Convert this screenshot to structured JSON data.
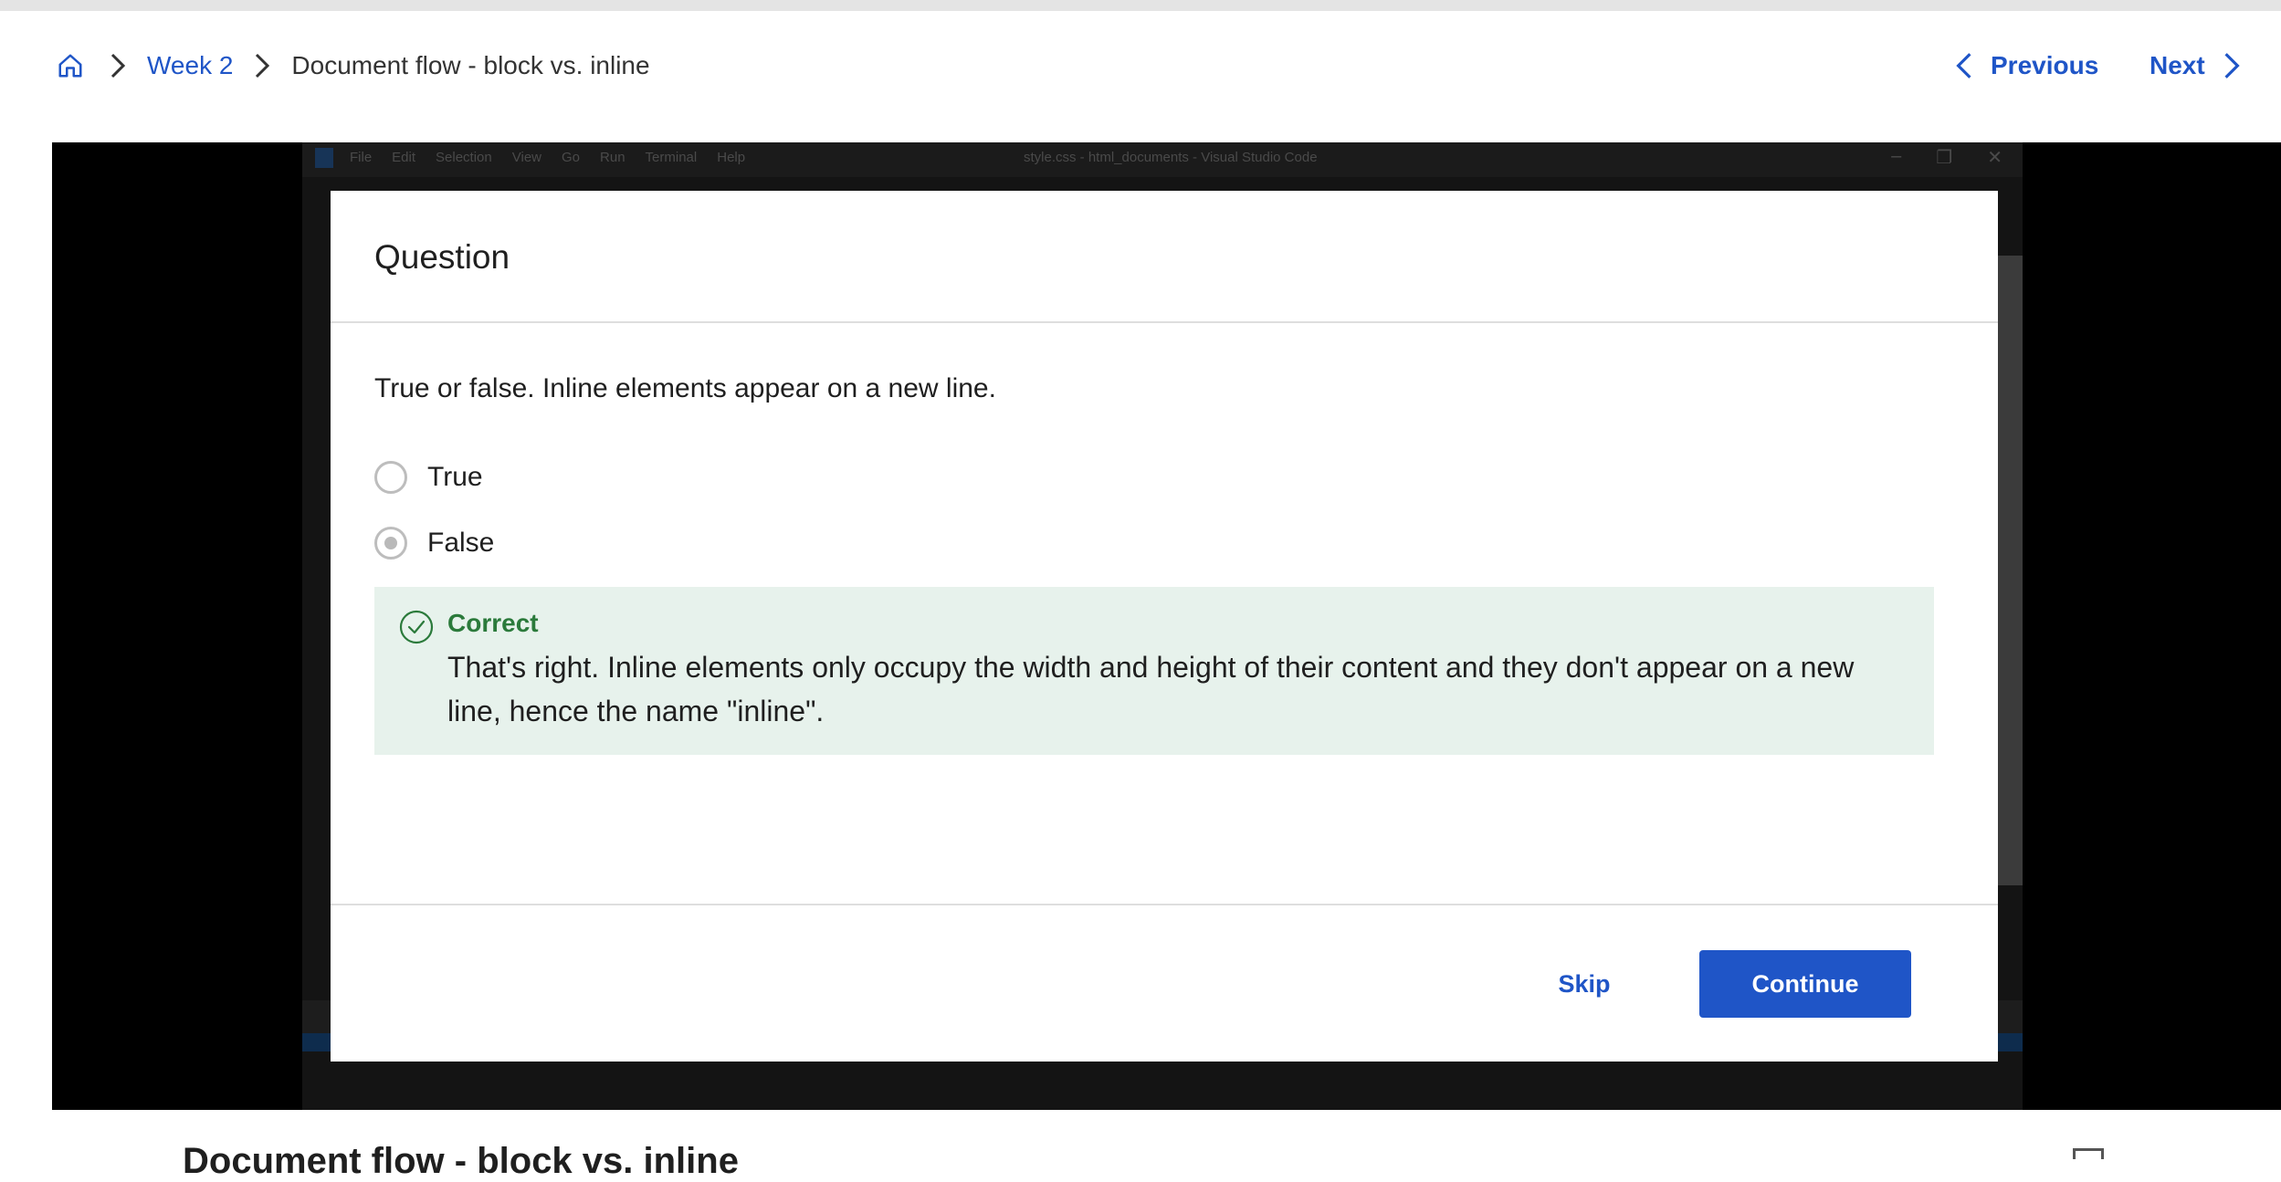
{
  "breadcrumb": {
    "home_icon": "home-icon",
    "week": "Week 2",
    "current": "Document flow - block vs. inline"
  },
  "nav": {
    "previous": "Previous",
    "next": "Next"
  },
  "video_background": {
    "menu": [
      "File",
      "Edit",
      "Selection",
      "View",
      "Go",
      "Run",
      "Terminal",
      "Help"
    ],
    "window_title": "style.css - html_documents - Visual Studio Code"
  },
  "modal": {
    "title": "Question",
    "question": "True or false. Inline elements appear on a new line.",
    "options": [
      {
        "label": "True",
        "selected": false
      },
      {
        "label": "False",
        "selected": true
      }
    ],
    "feedback": {
      "status": "Correct",
      "message": "That's right. Inline elements only occupy the width and height of their content and they don't appear on a new line, hence the name \"inline\"."
    },
    "skip_label": "Skip",
    "continue_label": "Continue"
  },
  "page_heading_partial": "Document flow - block vs. inline",
  "colors": {
    "link": "#1f55c7",
    "correct": "#2b7a3b",
    "feedback_bg": "#e7f2ec",
    "primary_button": "#1f55c7"
  }
}
